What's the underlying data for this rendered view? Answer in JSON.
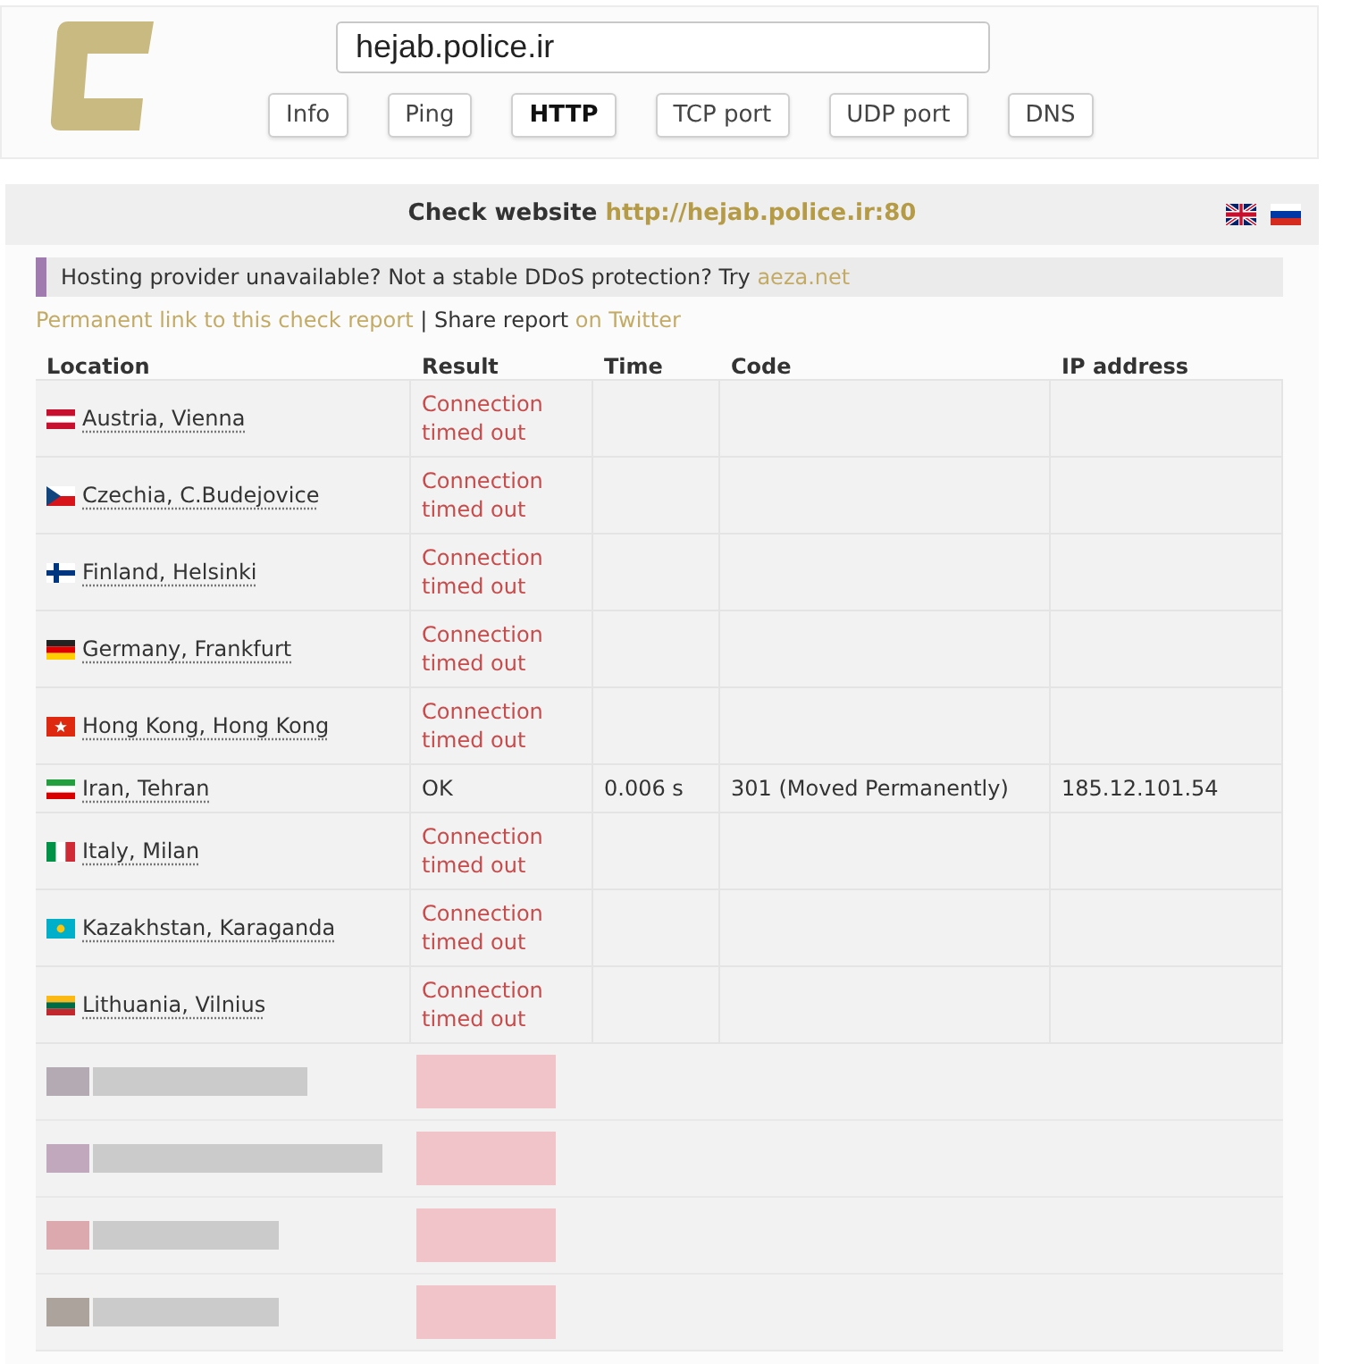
{
  "search": {
    "value": "hejab.police.ir"
  },
  "tabs": [
    {
      "label": "Info",
      "selected": false
    },
    {
      "label": "Ping",
      "selected": false
    },
    {
      "label": "HTTP",
      "selected": true
    },
    {
      "label": "TCP port",
      "selected": false
    },
    {
      "label": "UDP port",
      "selected": false
    },
    {
      "label": "DNS",
      "selected": false
    }
  ],
  "report": {
    "title": "Check website",
    "url": "http://hejab.police.ir:80"
  },
  "notice": {
    "text": "Hosting provider unavailable? Not a stable DDoS protection? Try",
    "link": "aeza.net"
  },
  "share": {
    "permalink": "Permanent link to this check report",
    "separator": "|",
    "label": "Share report",
    "link": "on Twitter"
  },
  "table": {
    "columns": [
      "Location",
      "Result",
      "Time",
      "Code",
      "IP address"
    ],
    "rows": [
      {
        "kind": "result",
        "location": "Austria, Vienna",
        "result": "Connection timed out",
        "failed": true
      },
      {
        "kind": "result",
        "location": "Czechia, C.Budejovice",
        "result": "Connection timed out",
        "failed": true
      },
      {
        "kind": "result",
        "location": "Finland, Helsinki",
        "result": "Connection timed out",
        "failed": true
      },
      {
        "kind": "result",
        "location": "Germany, Frankfurt",
        "result": "Connection timed out",
        "failed": true
      },
      {
        "kind": "result",
        "location": "Hong Kong, Hong Kong",
        "result": "Connection timed out",
        "failed": true
      },
      {
        "kind": "result",
        "location": "Iran, Tehran",
        "result": "OK",
        "failed": false,
        "time": "0.006 s",
        "code": "301 (Moved Permanently)",
        "ip": "185.12.101.54"
      },
      {
        "kind": "result",
        "location": "Italy, Milan",
        "result": "Connection timed out",
        "failed": true
      },
      {
        "kind": "result",
        "location": "Kazakhstan, Karaganda",
        "result": "Connection timed out",
        "failed": true
      },
      {
        "kind": "result",
        "location": "Lithuania, Vilnius",
        "result": "Connection timed out",
        "failed": true
      },
      {
        "kind": "blurred"
      },
      {
        "kind": "blurred"
      },
      {
        "kind": "blurred"
      },
      {
        "kind": "blurred"
      }
    ]
  }
}
